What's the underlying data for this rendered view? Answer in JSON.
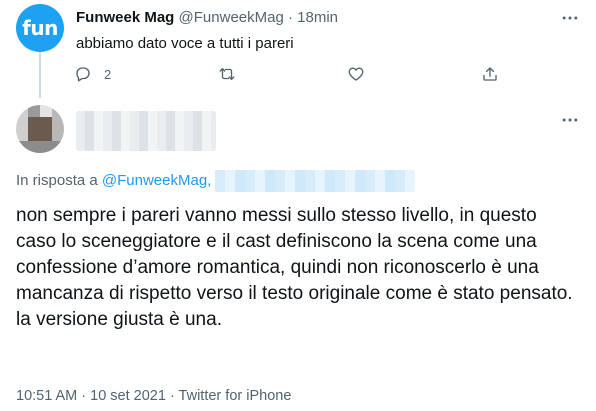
{
  "parent_tweet": {
    "avatar_text": "fun",
    "display_name": "Funweek Mag",
    "handle": "@FunweekMag",
    "separator": "·",
    "time": "18min",
    "more_icon": "more-horizontal-icon",
    "text": "abbiamo dato voce a tutti i pareri",
    "actions": {
      "reply_count": "2",
      "reply_icon": "reply-bubble-icon",
      "retweet_icon": "retweet-icon",
      "like_icon": "heart-icon",
      "share_icon": "share-upload-icon"
    }
  },
  "reply_tweet": {
    "reply_to_prefix": "In risposta a",
    "reply_to_mention": "@FunweekMag,",
    "text": "non sempre i pareri vanno messi sullo stesso livello, in questo caso lo sceneggiatore e il cast definiscono la scena come una confessione d’amore romantica, quindi non riconoscerlo è una mancanza di rispetto verso il testo originale come è stato pensato. la versione giusta è una.",
    "meta": "10:51 AM · 10 set 2021 · Twitter for iPhone",
    "more_icon": "more-horizontal-icon"
  },
  "colors": {
    "accent": "#1d9bf0",
    "secondary_text": "#536471",
    "primary_text": "#0f1419",
    "thread_line": "#cfd9de"
  }
}
